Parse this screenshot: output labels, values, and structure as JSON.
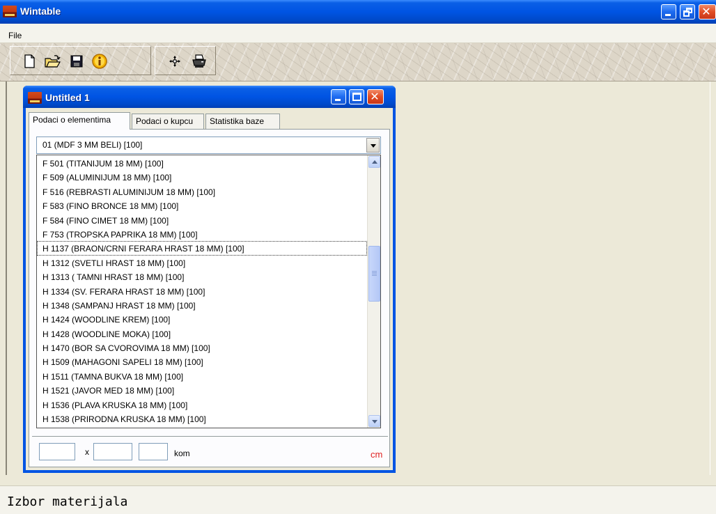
{
  "app": {
    "title": "Wintable"
  },
  "menu": {
    "file_label": "File"
  },
  "toolbar": {
    "tools": [
      "new-document-icon",
      "open-folder-icon",
      "save-disk-icon",
      "info-icon",
      "move-cross-icon",
      "printer-icon"
    ]
  },
  "child_window": {
    "title": "Untitled 1",
    "tabs": [
      "Podaci o elementima",
      "Podaci o kupcu",
      "Statistika baze"
    ],
    "active_tab": "Podaci o elementima",
    "combo": {
      "selected": "01 (MDF 3 MM BELI) [100]",
      "items": [
        "F 501 (TITANIJUM 18 MM) [100]",
        "F 509 (ALUMINIJUM 18 MM) [100]",
        "F 516 (REBRASTI ALUMINIJUM  18 MM) [100]",
        "F 583 (FINO BRONCE 18 MM) [100]",
        "F 584 (FINO CIMET 18 MM) [100]",
        "F 753 (TROPSKA PAPRIKA  18 MM) [100]",
        "H 1137 (BRAON/CRNI FERARA HRAST 18 MM) [100]",
        "H 1312  (SVETLI HRAST 18 MM) [100]",
        "H 1313 ( TAMNI HRAST 18 MM) [100]",
        "H 1334 (SV. FERARA HRAST 18 MM) [100]",
        "H 1348 (SAMPANJ HRAST 18 MM) [100]",
        "H 1424 (WOODLINE KREM) [100]",
        "H 1428 (WOODLINE MOKA) [100]",
        "H 1470 (BOR SA CVOROVIMA 18 MM) [100]",
        "H 1509 (MAHAGONI SAPELI 18 MM) [100]",
        "H 1511 (TAMNA BUKVA 18 MM) [100]",
        "H 1521 (JAVOR MED 18 MM) [100]",
        "H 1536 (PLAVA KRUSKA 18 MM) [100]",
        "H 1538 (PRIRODNA KRUSKA 18 MM) [100]"
      ],
      "focused_item": "H 1137 (BRAON/CRNI FERARA HRAST 18 MM) [100]"
    },
    "dimensions": {
      "x_label": "x",
      "qty_label": "kom",
      "unit_label": "cm",
      "width_value": "",
      "height_value": "",
      "qty_value": ""
    }
  },
  "status": {
    "text": "Izbor materijala"
  },
  "colors": {
    "titlebar": "#0054e3",
    "face": "#ece9d8",
    "unit_red": "#e02020"
  }
}
